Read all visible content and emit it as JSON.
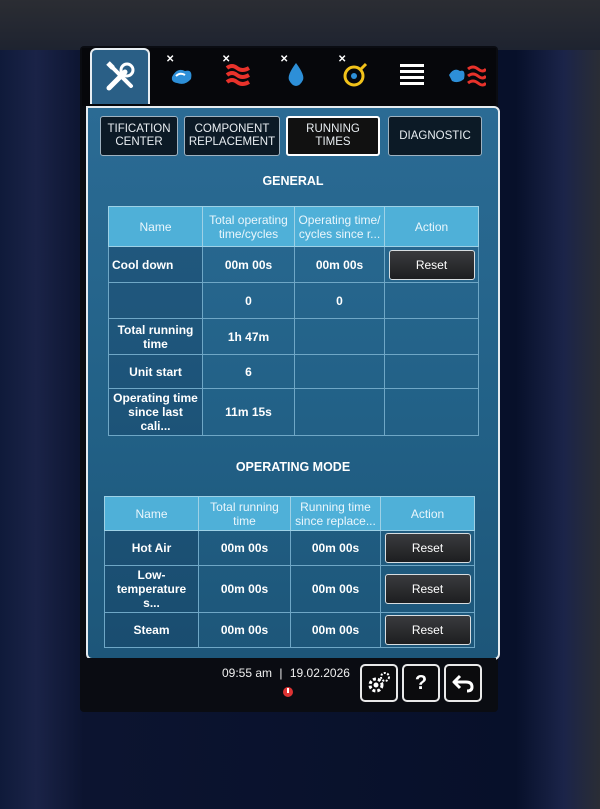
{
  "subtabs": [
    {
      "label": "TIFICATION\nCENTER"
    },
    {
      "label": "COMPONENT\nREPLACEMENT"
    },
    {
      "label": "RUNNING TIMES"
    },
    {
      "label": "DIAGNOSTIC"
    }
  ],
  "general": {
    "title": "GENERAL",
    "headers": [
      "Name",
      "Total operating time/cycles",
      "Operating time/ cycles since r...",
      "Action"
    ],
    "rows": [
      {
        "name": "Cool down",
        "total": "00m 00s",
        "since": "00m 00s",
        "action": "Reset"
      },
      {
        "name": "",
        "total": "0",
        "since": "0",
        "action": ""
      },
      {
        "name": "Total running time",
        "total": "1h 47m",
        "since": "",
        "action": ""
      },
      {
        "name": "Unit start",
        "total": "6",
        "since": "",
        "action": ""
      },
      {
        "name": "Operating time since last cali...",
        "total": "11m 15s",
        "since": "",
        "action": ""
      }
    ]
  },
  "operating_mode": {
    "title": "OPERATING MODE",
    "headers": [
      "Name",
      "Total running time",
      "Running time since replace...",
      "Action"
    ],
    "rows": [
      {
        "name": "Hot Air",
        "total": "00m 00s",
        "since": "00m 00s",
        "action": "Reset"
      },
      {
        "name": "Low-temperature s...",
        "total": "00m 00s",
        "since": "00m 00s",
        "action": "Reset"
      },
      {
        "name": "Steam",
        "total": "00m 00s",
        "since": "00m 00s",
        "action": "Reset"
      }
    ]
  },
  "footer": {
    "time": "09:55 am",
    "separator": "|",
    "date": "19.02.2026",
    "help_label": "?"
  },
  "icons": {
    "tab_active": "wrench-screwdriver-icon",
    "tab_2": "cleaning-icon",
    "tab_3": "heat-waves-icon",
    "tab_4": "water-drop-icon",
    "tab_5": "sensor-icon",
    "tab_6": "list-icon"
  },
  "colors": {
    "panel": "#2b6b94",
    "header": "#4fb0d8",
    "heat": "#e8322b",
    "water": "#2d8fd8",
    "accent_yellow": "#f2c21a"
  }
}
